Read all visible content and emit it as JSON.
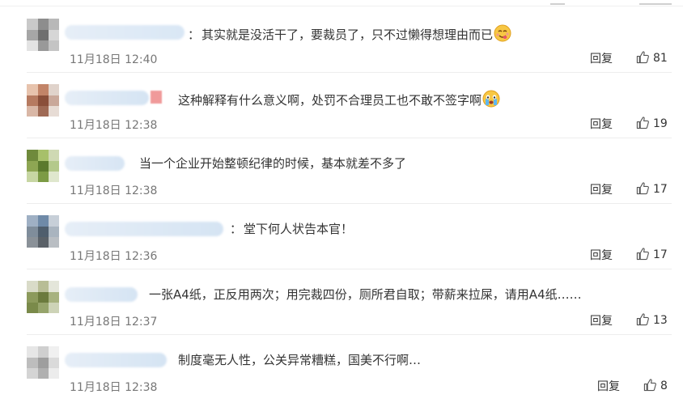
{
  "comments": [
    {
      "separator": "：",
      "text": "其实就是没活干了，要裁员了，只不过懒得想理由而已",
      "emoji": "yummy-face-emoji",
      "time": "11月18日 12:40",
      "reply_label": "回复",
      "likes": "81"
    },
    {
      "separator": "",
      "text": "这种解释有什么意义啊，处罚不合理员工也不敢不签字啊",
      "emoji": "crying-face-emoji",
      "time": "11月18日 12:38",
      "reply_label": "回复",
      "likes": "19"
    },
    {
      "separator": "",
      "text": "当一个企业开始整顿纪律的时候，基本就差不多了",
      "emoji": "",
      "time": "11月18日 12:38",
      "reply_label": "回复",
      "likes": "17"
    },
    {
      "separator": "：",
      "text": "堂下何人状告本官！",
      "emoji": "",
      "time": "11月18日 12:36",
      "reply_label": "回复",
      "likes": "17"
    },
    {
      "separator": "",
      "text": "一张A4纸，正反用两次；用完裁四份，厕所君自取；带薪来拉屎，请用A4纸……",
      "emoji": "",
      "time": "11月18日 12:37",
      "reply_label": "回复",
      "likes": "13"
    },
    {
      "separator": "",
      "text": "制度毫无人性，公关异常糟糕，国美不行啊…",
      "emoji": "",
      "time": "11月18日 12:38",
      "reply_label": "回复",
      "likes": "8"
    }
  ],
  "colors": {
    "text": "#333333",
    "time": "#777777",
    "divider": "#ededed",
    "name_blur": "#dce8f4"
  },
  "icons": {
    "like": "thumbs-up-icon"
  }
}
